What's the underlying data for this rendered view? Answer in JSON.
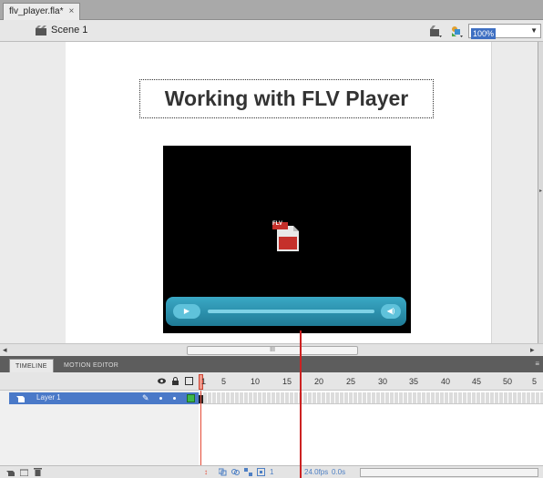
{
  "document": {
    "tab_title": "flv_player.fla*",
    "close_glyph": "×"
  },
  "editbar": {
    "scene_label": "Scene 1",
    "zoom_value": "100%"
  },
  "stage": {
    "title_text": "Working with FLV Player",
    "video": {
      "placeholder_icon": "flv-file-icon",
      "placeholder_text": "FLV",
      "background": "#000000",
      "controlbar_color": "#2b95b3"
    }
  },
  "scrollbar": {
    "thumb_label": "III"
  },
  "timeline": {
    "tabs": [
      "TIMELINE",
      "MOTION EDITOR"
    ],
    "active_tab": "TIMELINE",
    "ruler": [
      "1",
      "5",
      "10",
      "15",
      "20",
      "25",
      "30",
      "35",
      "40",
      "45",
      "50",
      "5"
    ],
    "layers": [
      {
        "name": "Layer 1",
        "color": "#3db84a"
      }
    ],
    "current_frame": "1",
    "fps": "24.0fps",
    "elapsed": "0.0s"
  },
  "colors": {
    "selection": "#4a79c8",
    "playhead": "#e44b36",
    "accent": "#3e6fc2"
  }
}
